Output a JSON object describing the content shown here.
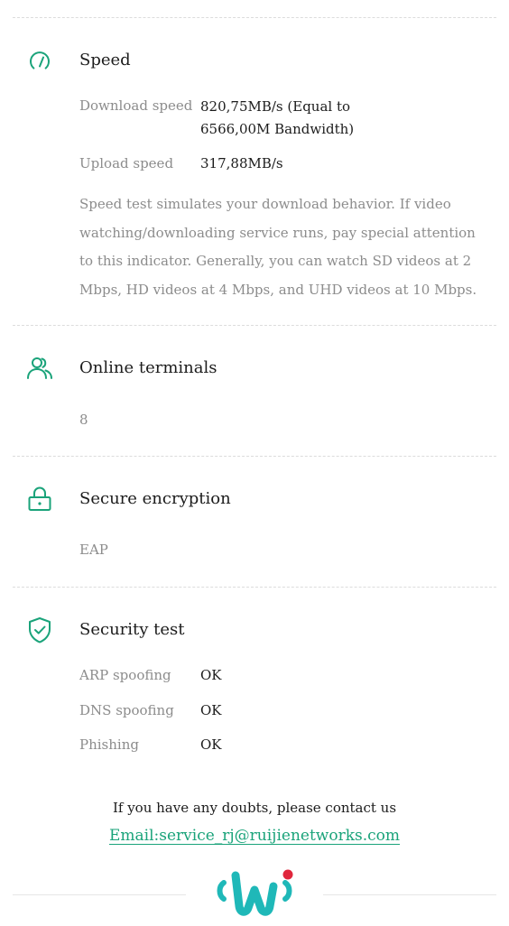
{
  "colors": {
    "accent": "#1aa37a",
    "text_primary": "#1c1c1c",
    "text_secondary": "#8c8c8c",
    "divider": "#dcdcdc",
    "logo_teal": "#1fb8b8",
    "logo_red": "#e0263c"
  },
  "speed": {
    "icon": "speedometer-icon",
    "title": "Speed",
    "download_label": "Download speed",
    "download_value": "820,75MB/s (Equal to 6566,00M Bandwidth)",
    "upload_label": "Upload speed",
    "upload_value": "317,88MB/s",
    "description": "Speed test simulates your download behavior. If video watching/downloading service runs, pay special attention to this indicator. Generally, you can watch SD videos at 2 Mbps, HD videos at 4 Mbps, and UHD videos at 10 Mbps."
  },
  "terminals": {
    "icon": "users-icon",
    "title": "Online terminals",
    "value": "8"
  },
  "encryption": {
    "icon": "lock-icon",
    "title": "Secure encryption",
    "value": "EAP"
  },
  "security": {
    "icon": "shield-check-icon",
    "title": "Security test",
    "items": [
      {
        "label": "ARP spoofing",
        "value": "OK"
      },
      {
        "label": "DNS spoofing",
        "value": "OK"
      },
      {
        "label": "Phishing",
        "value": "OK"
      }
    ]
  },
  "contact": {
    "text": "If you have any doubts, please contact us",
    "email": "Email:service_rj@ruijienetworks.com"
  },
  "footer": {
    "logo": "ruijie-wifi-logo"
  }
}
